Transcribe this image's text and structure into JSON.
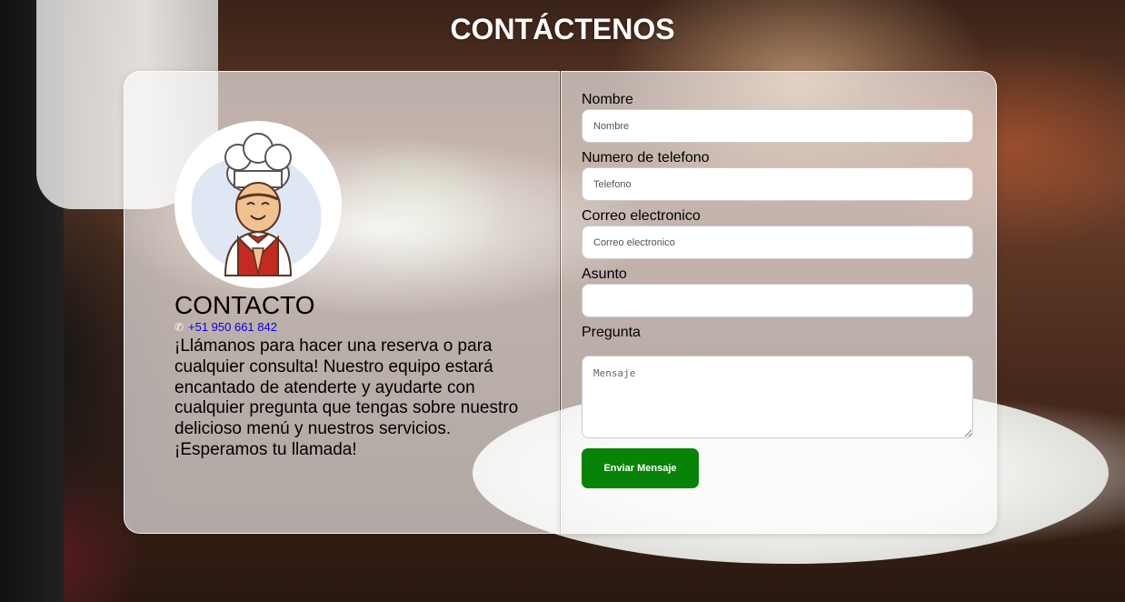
{
  "page": {
    "title": "CONTÁCTENOS"
  },
  "contact": {
    "heading": "CONTACTO",
    "phone_icon": "phone-icon",
    "phone": "+51 950 661 842",
    "description": "¡Llámanos para hacer una reserva o para cualquier consulta! Nuestro equipo estará encantado de atenderte y ayudarte con cualquier pregunta que tengas sobre nuestro delicioso menú y nuestros servicios. ¡Esperamos tu llamada!",
    "avatar_icon": "chef-avatar-icon"
  },
  "form": {
    "name_label": "Nombre",
    "name_placeholder": "Nombre",
    "phone_label": "Numero de telefono",
    "phone_placeholder": "Telefono",
    "email_label": "Correo electronico",
    "email_placeholder": "Correo electronico",
    "subject_label": "Asunto",
    "subject_placeholder": "",
    "question_label": "Pregunta",
    "message_placeholder": "Mensaje",
    "submit_label": "Enviar Mensaje"
  },
  "colors": {
    "submit_button": "#078407",
    "phone_link": "#0000ee",
    "title": "#ffffff"
  }
}
